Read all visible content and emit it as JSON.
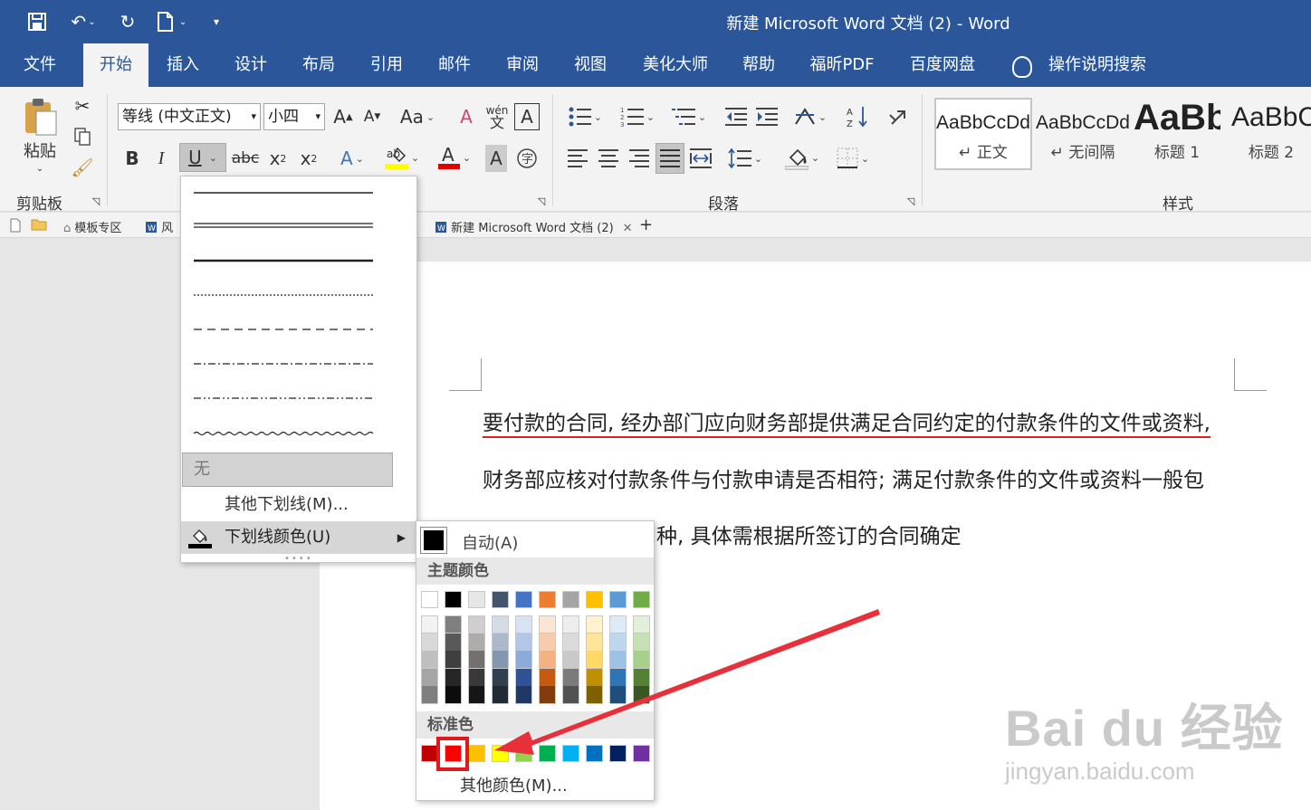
{
  "window": {
    "title_doc": "新建 Microsoft Word 文档 (2)",
    "title_sep": "-",
    "title_app": "Word"
  },
  "tabs": [
    "文件",
    "开始",
    "插入",
    "设计",
    "布局",
    "引用",
    "邮件",
    "审阅",
    "视图",
    "美化大师",
    "帮助",
    "福昕PDF",
    "百度网盘",
    "操作说明搜索"
  ],
  "active_tab": "开始",
  "ribbon": {
    "paste_label": "粘贴",
    "font_name": "等线 (中文正文)",
    "font_size": "小四",
    "groups": {
      "clipboard": "剪贴板",
      "paragraph": "段落",
      "styles": "样式"
    },
    "styles": [
      {
        "sample": "AaBbCcDd",
        "name": "↵ 正文"
      },
      {
        "sample": "AaBbCcDd",
        "name": "↵ 无间隔"
      },
      {
        "sample": "AaBb",
        "name": "标题 1"
      },
      {
        "sample": "AaBbC",
        "name": "标题 2"
      }
    ]
  },
  "docbar": {
    "tab1": "模板专区",
    "tab2": "风",
    "tab3": "新建 Microsoft Word 文档 (2)",
    "new_tab": "+"
  },
  "document": {
    "lines": [
      "要付款的合同, 经办部门应向财务部提供满足合同约定的付款条件的文件或资料,",
      "财务部应核对付款条件与付款申请是否相符; 满足付款条件的文件或资料一般包",
      "种,  具体需根据所签订的合同确定"
    ]
  },
  "underline_menu": {
    "none_label": "无",
    "more_label": "其他下划线(M)...",
    "color_label": "下划线颜色(U)"
  },
  "color_menu": {
    "auto_label": "自动(A)",
    "theme_header": "主题颜色",
    "standard_header": "标准色",
    "more_label": "其他颜色(M)...",
    "theme_top": [
      "#ffffff",
      "#000000",
      "#e7e6e6",
      "#44546a",
      "#4472c4",
      "#ed7d31",
      "#a5a5a5",
      "#ffc000",
      "#5b9bd5",
      "#70ad47"
    ],
    "theme_shades": [
      [
        "#f2f2f2",
        "#7f7f7f",
        "#d0cece",
        "#d6dce4",
        "#d9e2f3",
        "#fbe5d5",
        "#ededed",
        "#fff2cc",
        "#deebf6",
        "#e2efd9"
      ],
      [
        "#d8d8d8",
        "#595959",
        "#aeabab",
        "#adb9ca",
        "#b4c6e7",
        "#f7cbac",
        "#dbdbdb",
        "#fee599",
        "#bdd7ee",
        "#c5e0b3"
      ],
      [
        "#bfbfbf",
        "#3f3f3f",
        "#757070",
        "#8496b0",
        "#8eaadb",
        "#f4b183",
        "#c9c9c9",
        "#ffd965",
        "#9cc3e5",
        "#a8d08d"
      ],
      [
        "#a5a5a5",
        "#262626",
        "#3a3838",
        "#323f4f",
        "#2f5496",
        "#c55a11",
        "#7b7b7b",
        "#bf9000",
        "#2e75b5",
        "#538135"
      ],
      [
        "#7f7f7f",
        "#0c0c0c",
        "#171616",
        "#222a35",
        "#1f3864",
        "#833c0b",
        "#525252",
        "#7f6000",
        "#1e4e79",
        "#375623"
      ]
    ],
    "standard": [
      "#c00000",
      "#ff0000",
      "#ffc000",
      "#ffff00",
      "#92d050",
      "#00b050",
      "#00b0f0",
      "#0070c0",
      "#002060",
      "#7030a0"
    ],
    "selected_standard": "#ff0000"
  },
  "watermark": {
    "brand": "Bai du 经验",
    "url": "jingyan.baidu.com"
  },
  "colors": {
    "title_bg": "#2b579a",
    "ribbon_bg": "#f3f3f3",
    "arrow": "#e8303a"
  }
}
